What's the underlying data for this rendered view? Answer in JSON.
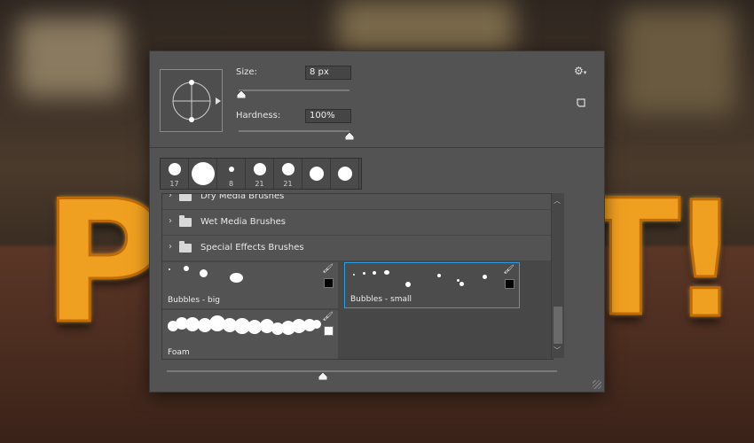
{
  "brush_preview": {
    "size_label": "Size:",
    "size_value": "8 px",
    "hardness_label": "Hardness:",
    "hardness_value": "100%",
    "size_slider": 0.02,
    "hardness_slider": 1.0
  },
  "toolbar": {
    "settings_icon": "gear-icon",
    "new_preset_icon": "new-preset-icon"
  },
  "recent_brushes": [
    {
      "size": "17",
      "diameter": 14
    },
    {
      "size": "",
      "diameter": 26
    },
    {
      "size": "8",
      "diameter": 6
    },
    {
      "size": "21",
      "diameter": 14
    },
    {
      "size": "21",
      "diameter": 14
    },
    {
      "size": "",
      "diameter": 16
    },
    {
      "size": "",
      "diameter": 16
    }
  ],
  "folders": [
    {
      "label": "Dry Media Brushes"
    },
    {
      "label": "Wet Media Brushes"
    },
    {
      "label": "Special Effects Brushes"
    }
  ],
  "brush_tiles": [
    {
      "name": "Bubbles - big",
      "swatch": "#000000"
    },
    {
      "name": "Bubbles - small",
      "swatch": "#000000"
    },
    {
      "name": "Foam",
      "swatch": "#ffffff"
    }
  ],
  "accent_color": "#2aa0e0",
  "preview_size_slider": 0.4
}
